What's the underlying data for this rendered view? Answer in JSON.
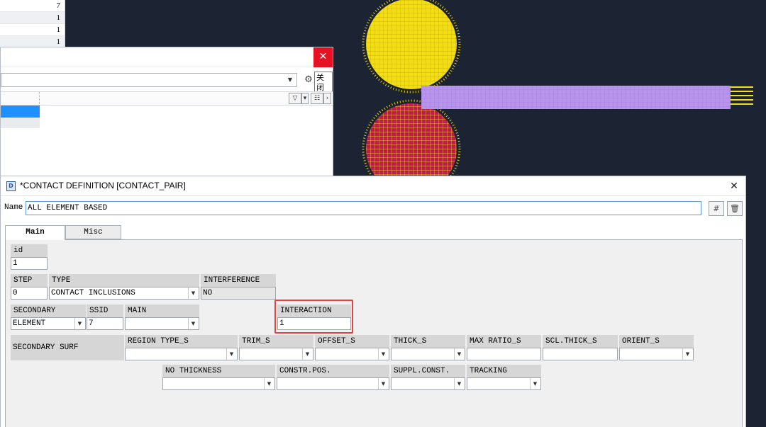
{
  "background_table": {
    "values": [
      "7",
      "1",
      "1",
      "1"
    ]
  },
  "back_dialog": {
    "close_tooltip": "关闭",
    "icons": {
      "close": "close-icon",
      "gear": "gear-icon",
      "filter": "filter-icon",
      "columns": "columns-icon"
    }
  },
  "dialog": {
    "title": "*CONTACT DEFINITION [CONTACT_PAIR]",
    "name_label": "Name",
    "name_value": "ALL ELEMENT BASED",
    "tabs": [
      {
        "label": "Main"
      },
      {
        "label": "Misc"
      }
    ],
    "fields": {
      "id": {
        "label": "id",
        "value": "1"
      },
      "step": {
        "label": "STEP",
        "value": "0"
      },
      "type": {
        "label": "TYPE",
        "value": "CONTACT INCLUSIONS"
      },
      "interference": {
        "label": "INTERFERENCE",
        "value": "NO"
      },
      "secondary": {
        "label": "SECONDARY",
        "value": "ELEMENT"
      },
      "ssid": {
        "label": "SSID",
        "value": "7"
      },
      "main": {
        "label": "MAIN",
        "value": ""
      },
      "interaction": {
        "label": "INTERACTION",
        "value": "1"
      },
      "secondary_surf": {
        "label": "SECONDARY SURF"
      },
      "region_type_s": {
        "label": "REGION TYPE_S",
        "value": ""
      },
      "trim_s": {
        "label": "TRIM_S",
        "value": ""
      },
      "offset_s": {
        "label": "OFFSET_S",
        "value": ""
      },
      "thick_s": {
        "label": "THICK_S",
        "value": ""
      },
      "max_ratio_s": {
        "label": "MAX RATIO_S",
        "value": ""
      },
      "scl_thick_s": {
        "label": "SCL.THICK_S",
        "value": ""
      },
      "orient_s": {
        "label": "ORIENT_S",
        "value": ""
      },
      "no_thickness": {
        "label": "NO THICKNESS",
        "value": ""
      },
      "constr_pos": {
        "label": "CONSTR.POS.",
        "value": ""
      },
      "suppl_const": {
        "label": "SUPPL.CONST.",
        "value": ""
      },
      "tracking": {
        "label": "TRACKING",
        "value": ""
      }
    }
  },
  "colors": {
    "viewport_bg": "#1c2333",
    "sphere_top": "#f4e21a",
    "sphere_bottom": "#c2185b",
    "bar": "#b48be8",
    "highlight": "#e8413c",
    "selection": "#1e90ff"
  }
}
